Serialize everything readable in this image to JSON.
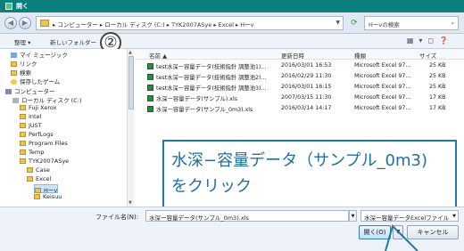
{
  "window": {
    "title": "開く"
  },
  "address": {
    "path": "▸ コンピューター ▸ ローカル ディスク (C:) ▸ TYK2007ASye ▸ Excel ▸ Hーv",
    "search_placeholder": "Hーvの検索"
  },
  "toolbar": {
    "organize": "整理 ▾",
    "new_folder": "新しいフォルダー"
  },
  "annotation": {
    "step_marker": "②"
  },
  "sidebar": {
    "items": [
      {
        "label": "マイ ミュージック",
        "icon": "music"
      },
      {
        "label": "リンク",
        "icon": "folder"
      },
      {
        "label": "検索",
        "icon": "folder"
      },
      {
        "label": "保存したゲーム",
        "icon": "star"
      },
      {
        "label": "コンピューター",
        "icon": "pc"
      },
      {
        "label": "ローカル ディスク (C:)",
        "icon": "drive"
      },
      {
        "label": "Fuji Xerox",
        "icon": "folder"
      },
      {
        "label": "Intel",
        "icon": "folder"
      },
      {
        "label": "JUST",
        "icon": "folder"
      },
      {
        "label": "PerfLogs",
        "icon": "folder"
      },
      {
        "label": "Program Files",
        "icon": "folder"
      },
      {
        "label": "Temp",
        "icon": "folder"
      },
      {
        "label": "TYK2007ASye",
        "icon": "folder"
      },
      {
        "label": "Case",
        "icon": "folder"
      },
      {
        "label": "Excel",
        "icon": "folder"
      },
      {
        "label": "Hーv",
        "icon": "folder"
      },
      {
        "label": "Keisuu",
        "icon": "folder"
      }
    ]
  },
  "file_list": {
    "headers": {
      "name": "名前 ▲",
      "date": "更新日時",
      "type": "種類",
      "size": "サイズ"
    },
    "rows": [
      {
        "name": "test水深ー容量データ(技術指針 調整池1)...",
        "date": "2016/03/01 16:53",
        "type": "Microsoft Excel 97...",
        "size": "25 KB"
      },
      {
        "name": "test水深ー容量データ(技術指針 調整池2)...",
        "date": "2016/02/29 11:30",
        "type": "Microsoft Excel 97...",
        "size": "25 KB"
      },
      {
        "name": "test水深ー容量データ(技術指針 調整池3)...",
        "date": "2016/03/01 16:15",
        "type": "Microsoft Excel 97...",
        "size": "25 KB"
      },
      {
        "name": "水深ー容量データ(サンプル).xls",
        "date": "2007/03/15 11:30",
        "type": "Microsoft Excel 97...",
        "size": "17 KB"
      },
      {
        "name": "水深ー容量データ(サンプル_0m3).xls",
        "date": "2016/03/14 14:17",
        "type": "Microsoft Excel 97...",
        "size": "17 KB"
      }
    ]
  },
  "callout": {
    "line1": "水深−容量データ（サンプル_0m3)",
    "line2": "をクリック"
  },
  "footer": {
    "filename_label": "ファイル名(N):",
    "filename_value": "水深ー容量データ(サンプル_0m3).xls",
    "filter_value": "水深ー容量データExcelファイル",
    "open_label": "開く(O)",
    "cancel_label": "キャンセル"
  }
}
